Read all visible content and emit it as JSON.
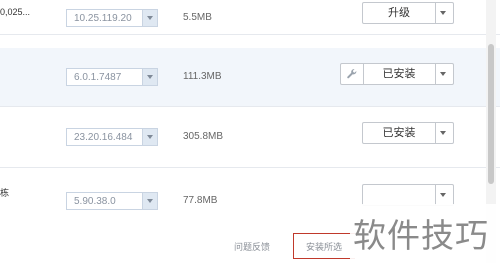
{
  "rows": [
    {
      "name": "0,025...",
      "version": "10.25.119.20",
      "size": "5.5MB",
      "action": "升级",
      "tool_icon": null
    },
    {
      "name": "",
      "version": "6.0.1.7487",
      "size": "111.3MB",
      "action": "已安装",
      "tool_icon": "wrench-icon"
    },
    {
      "name": "",
      "version": "23.20.16.484",
      "size": "305.8MB",
      "action": "已安装",
      "tool_icon": null
    },
    {
      "name": "栋",
      "version": "5.90.38.0",
      "size": "77.8MB",
      "action": "",
      "tool_icon": null
    }
  ],
  "footer": {
    "secondary_label": "问题反馈",
    "primary_label": "安装所选"
  },
  "watermark": "软件技巧",
  "colors": {
    "highlight_row": "#f2f6fb",
    "primary_border": "#c0392b",
    "select_border": "#c9d4e2"
  }
}
